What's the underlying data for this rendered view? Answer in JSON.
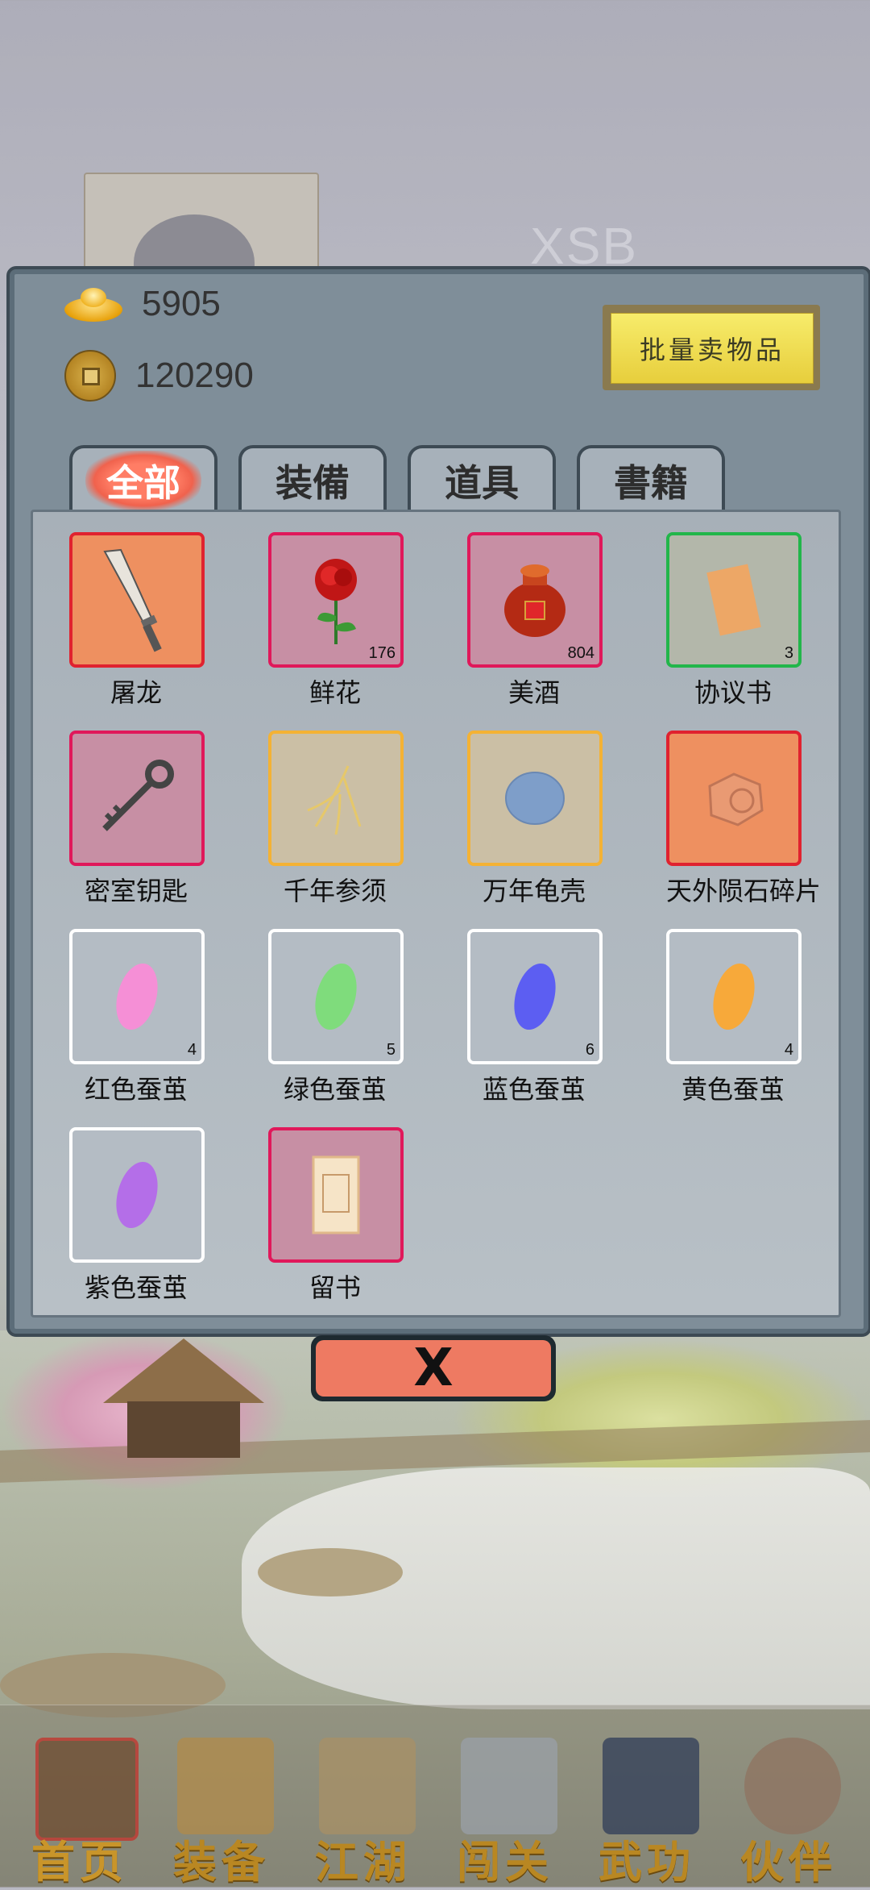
{
  "background": {
    "watermark": "XSB"
  },
  "resources": {
    "ingot_value": "5905",
    "coin_value": "120290"
  },
  "sell_button": {
    "label": "批量卖物品"
  },
  "tabs": [
    {
      "label": "全部",
      "active": true
    },
    {
      "label": "装備",
      "active": false
    },
    {
      "label": "道具",
      "active": false
    },
    {
      "label": "書籍",
      "active": false
    }
  ],
  "items": [
    {
      "name": "屠龙",
      "count": "",
      "rarity": "orange",
      "icon": "sword-icon"
    },
    {
      "name": "鲜花",
      "count": "176",
      "rarity": "pink",
      "icon": "rose-icon"
    },
    {
      "name": "美酒",
      "count": "804",
      "rarity": "pink",
      "icon": "wine-jar-icon"
    },
    {
      "name": "协议书",
      "count": "3",
      "rarity": "green",
      "icon": "scroll-icon"
    },
    {
      "name": "密室钥匙",
      "count": "",
      "rarity": "pink",
      "icon": "key-icon"
    },
    {
      "name": "千年参须",
      "count": "",
      "rarity": "yellow",
      "icon": "ginseng-icon"
    },
    {
      "name": "万年龟壳",
      "count": "",
      "rarity": "yellow",
      "icon": "turtle-shell-icon"
    },
    {
      "name": "天外陨石碎片",
      "count": "",
      "rarity": "orange",
      "icon": "meteorite-icon"
    },
    {
      "name": "红色蚕茧",
      "count": "4",
      "rarity": "white",
      "icon": "cocoon-icon",
      "color": "#f58fd6"
    },
    {
      "name": "绿色蚕茧",
      "count": "5",
      "rarity": "white",
      "icon": "cocoon-icon",
      "color": "#7fdc7c"
    },
    {
      "name": "蓝色蚕茧",
      "count": "6",
      "rarity": "white",
      "icon": "cocoon-icon",
      "color": "#5c5ef2"
    },
    {
      "name": "黄色蚕茧",
      "count": "4",
      "rarity": "white",
      "icon": "cocoon-icon",
      "color": "#f7a93a"
    },
    {
      "name": "紫色蚕茧",
      "count": "",
      "rarity": "white",
      "icon": "cocoon-icon",
      "color": "#b46ee8"
    },
    {
      "name": "留书",
      "count": "",
      "rarity": "pink",
      "icon": "letter-icon"
    }
  ],
  "close_button": {
    "label": "X"
  },
  "nav": [
    {
      "label": "首页",
      "icon": "house-icon"
    },
    {
      "label": "装备",
      "icon": "armor-icon"
    },
    {
      "label": "江湖",
      "icon": "map-scroll-icon"
    },
    {
      "label": "闯关",
      "icon": "crossed-swords-icon"
    },
    {
      "label": "武功",
      "icon": "book-icon"
    },
    {
      "label": "伙伴",
      "icon": "companions-icon"
    }
  ]
}
